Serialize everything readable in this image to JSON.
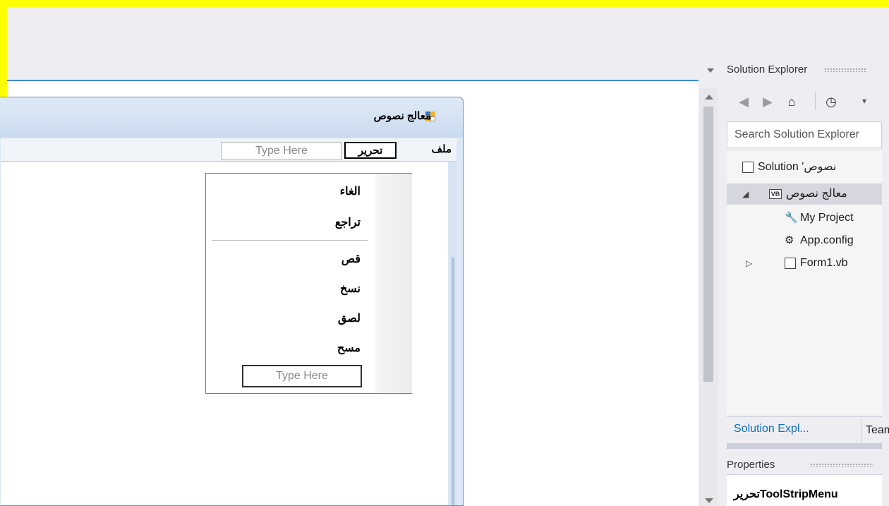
{
  "form": {
    "title": "معالج نصوص",
    "menu_file": "ملف",
    "menu_edit": "تحرير",
    "menu_type_here": "Type Here"
  },
  "dropdown": {
    "items": [
      "الغاء",
      "تراجع",
      "قص",
      "نسخ",
      "لصق",
      "مسح"
    ],
    "type_here": "Type Here"
  },
  "solution_explorer": {
    "title": "Solution Explorer",
    "search_placeholder": "Search Solution Explorer",
    "tree": [
      {
        "label": "Solution 'نصوص"
      },
      {
        "label": "معالج نصوص",
        "badge": "VB"
      },
      {
        "label": "My Project"
      },
      {
        "label": "App.config"
      },
      {
        "label": "Form1.vb"
      }
    ],
    "tab_active": "Solution Expl...",
    "tab_other": "Team"
  },
  "properties": {
    "title": "Properties",
    "object": "تحريرToolStripMenu"
  },
  "colors": {
    "accent": "#3c8dd0",
    "highlight_border": "#ffff00",
    "selected_row": "#d6d6de"
  }
}
